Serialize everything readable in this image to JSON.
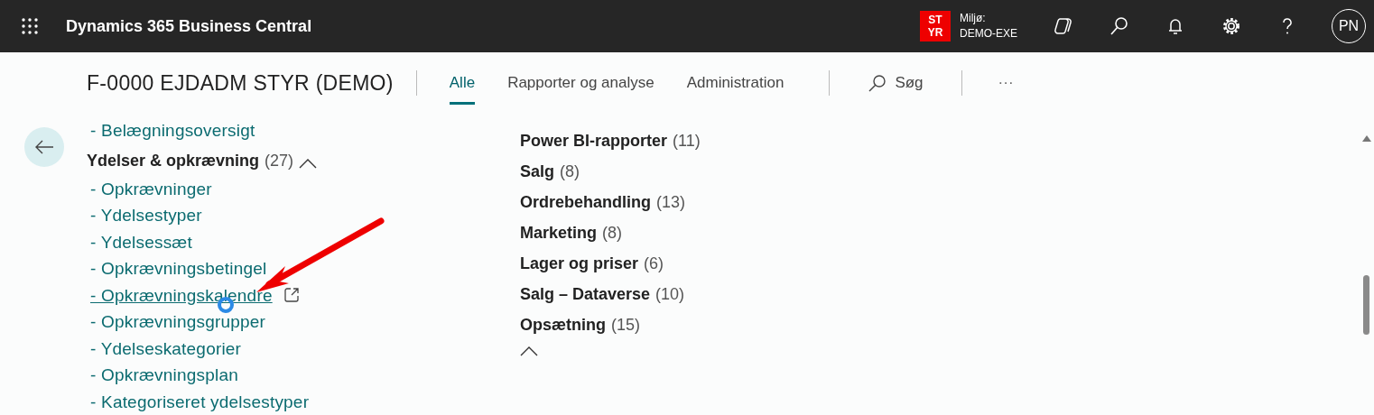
{
  "top_bar": {
    "app_title": "Dynamics 365 Business Central",
    "environment_badge": "ST\nYR",
    "environment_label": "Miljø:",
    "environment_name": "DEMO-EXE",
    "avatar": "PN"
  },
  "header": {
    "company": "F-0000 EJDADM STYR (DEMO)",
    "tabs": [
      {
        "label": "Alle",
        "selected": true
      },
      {
        "label": "Rapporter og analyse",
        "selected": false
      },
      {
        "label": "Administration",
        "selected": false
      }
    ],
    "search_label": "Søg",
    "more": "···"
  },
  "left_column": {
    "items_before": [
      {
        "label": "- Belægningsoversigt",
        "hovered": false
      }
    ],
    "group": {
      "title": "Ydelser & opkrævning",
      "count": "(27)",
      "expanded": true,
      "items": [
        {
          "label": "- Opkrævninger",
          "hovered": false
        },
        {
          "label": "- Ydelsestyper",
          "hovered": false
        },
        {
          "label": "- Ydelsessæt",
          "hovered": false
        },
        {
          "label": "- Opkrævningsbetingel",
          "hovered": false
        },
        {
          "label": "- Opkrævningskalendre",
          "hovered": true
        },
        {
          "label": "- Opkrævningsgrupper",
          "hovered": false
        },
        {
          "label": "- Ydelseskategorier",
          "hovered": false
        },
        {
          "label": "- Opkrævningsplan",
          "hovered": false
        },
        {
          "label": "- Kategoriseret ydelsestyper",
          "hovered": false
        }
      ]
    }
  },
  "right_column": {
    "groups": [
      {
        "title": "Power BI-rapporter",
        "count": "(11)"
      },
      {
        "title": "Salg",
        "count": "(8)"
      },
      {
        "title": "Ordrebehandling",
        "count": "(13)"
      },
      {
        "title": "Marketing",
        "count": "(8)"
      },
      {
        "title": "Lager og priser",
        "count": "(6)"
      },
      {
        "title": "Salg – Dataverse",
        "count": "(10)"
      },
      {
        "title": "Opsætning",
        "count": "(15)"
      }
    ],
    "expanded": true
  }
}
